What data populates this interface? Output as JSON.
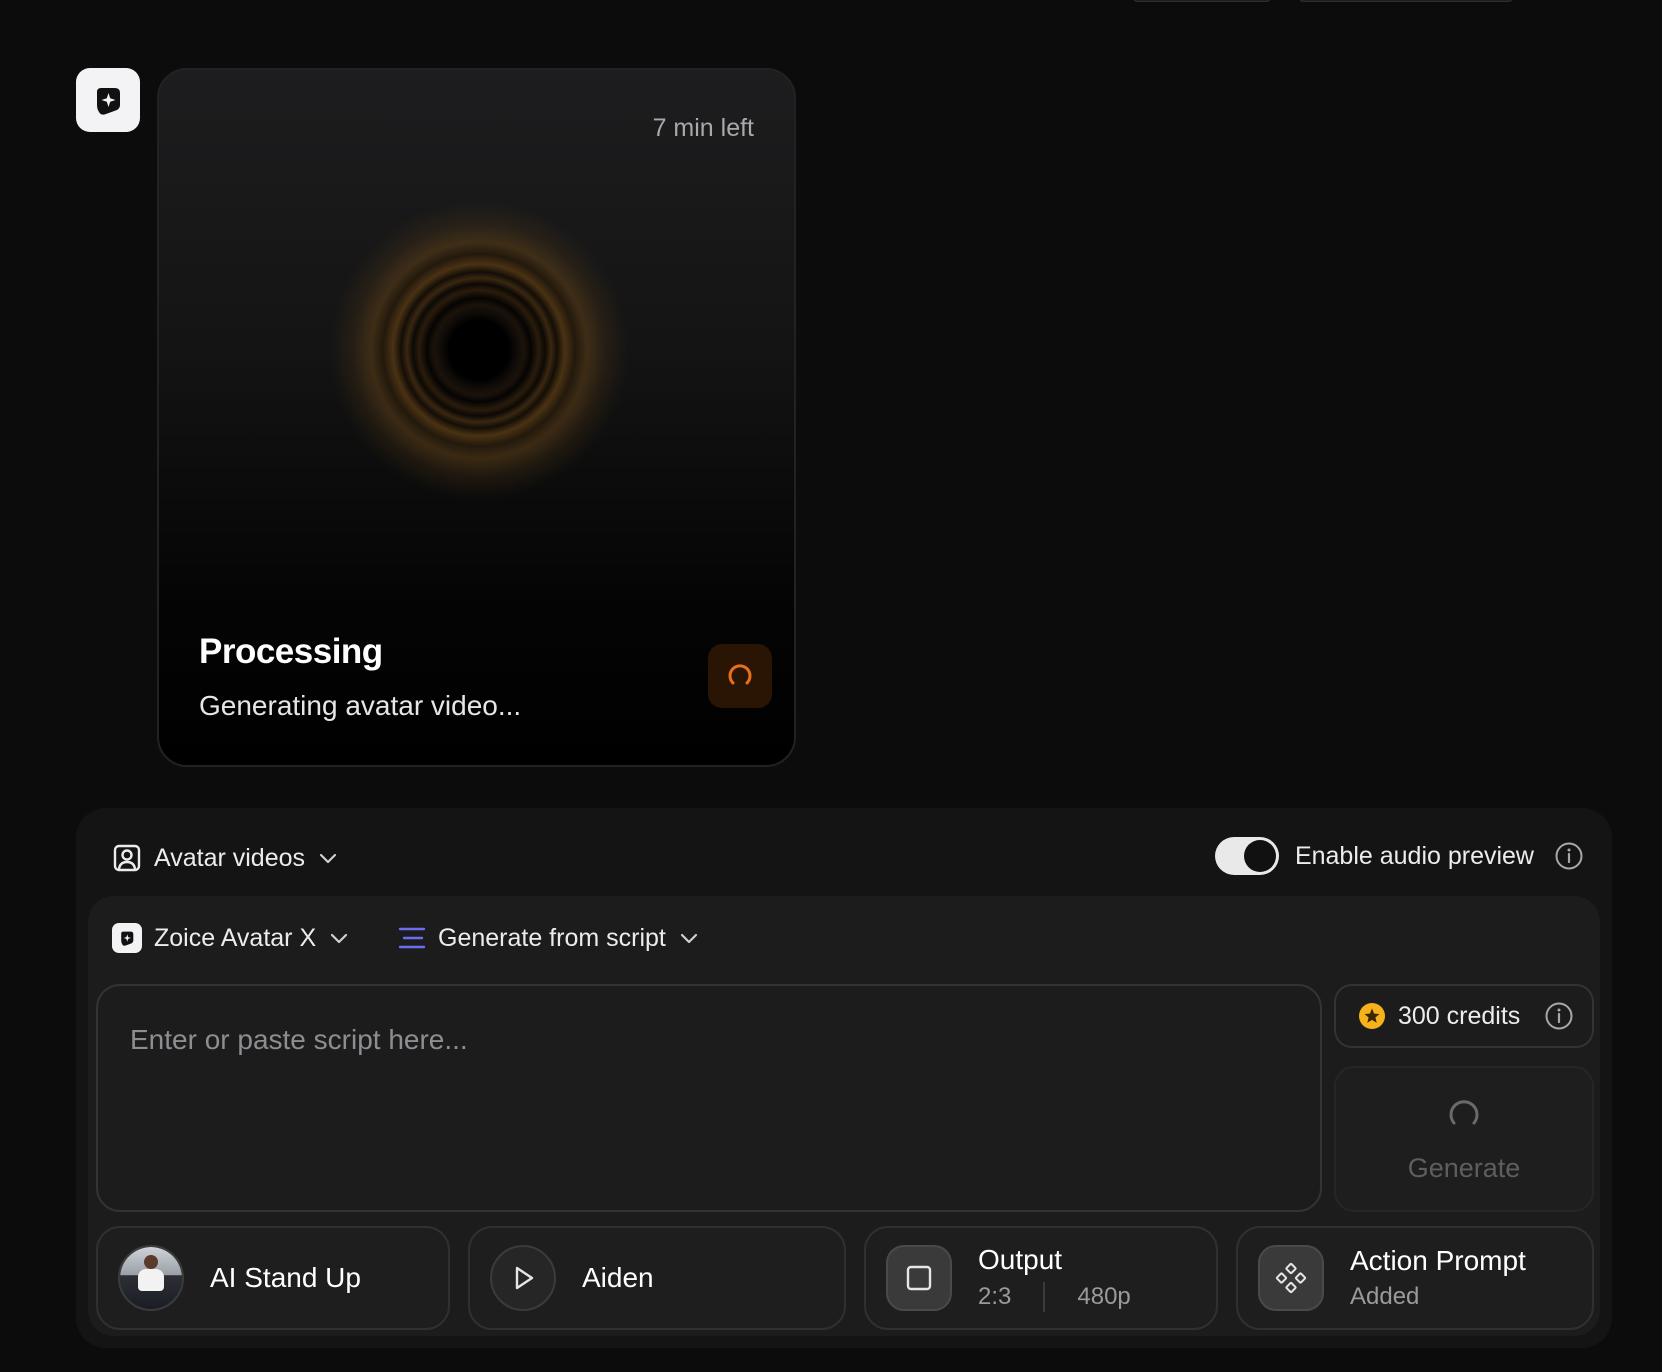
{
  "processing": {
    "time_left": "7 min left",
    "title": "Processing",
    "subtitle": "Generating avatar video..."
  },
  "controls": {
    "mode": "Avatar videos",
    "audio_preview_label": "Enable audio preview",
    "audio_preview_enabled": true,
    "model": "Zoice Avatar X",
    "generation_mode": "Generate from script"
  },
  "script": {
    "placeholder": "Enter or paste script here..."
  },
  "credits": {
    "label": "300 credits"
  },
  "generate": {
    "label": "Generate"
  },
  "chips": {
    "style": "AI Stand Up",
    "voice": "Aiden",
    "output_label": "Output",
    "output_ratio": "2:3",
    "output_resolution": "480p",
    "action_label": "Action Prompt",
    "action_status": "Added"
  },
  "colors": {
    "accent_orange": "#e8701a",
    "credit_star": "#f5b21b",
    "script_icon": "#6c6cf0"
  },
  "icons": {
    "app": "sparkle-logo-icon",
    "spinner": "spinner-icon",
    "mode": "avatar-portrait-icon",
    "chevron": "chevron-down-icon",
    "info": "info-icon",
    "script": "text-lines-icon",
    "credit": "star-coin-icon",
    "voice": "play-icon",
    "output": "square-icon",
    "action": "action-pattern-icon"
  }
}
